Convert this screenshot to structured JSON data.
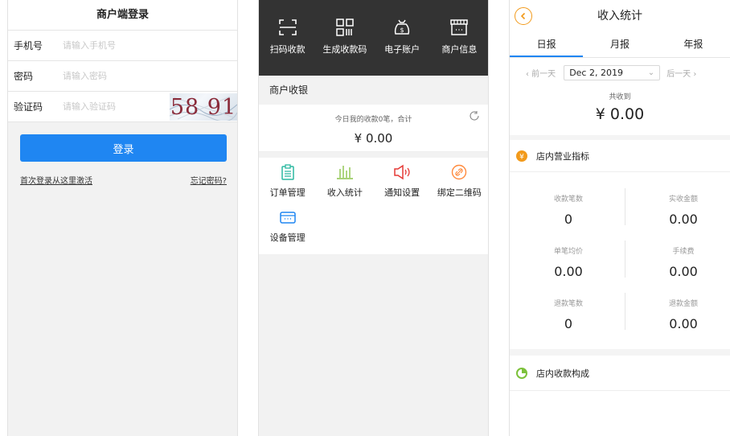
{
  "login": {
    "title": "商户端登录",
    "phone_label": "手机号",
    "phone_placeholder": "请输入手机号",
    "password_label": "密码",
    "password_placeholder": "请输入密码",
    "captcha_label": "验证码",
    "captcha_placeholder": "请输入验证码",
    "captcha_text": "58 91",
    "login_button": "登录",
    "activate_link": "首次登录从这里激活",
    "forgot_link": "忘记密码?"
  },
  "cashier": {
    "top_actions": [
      {
        "label": "扫码收款",
        "icon": "scan-icon"
      },
      {
        "label": "生成收款码",
        "icon": "qrcode-icon"
      },
      {
        "label": "电子账户",
        "icon": "money-bag-icon"
      },
      {
        "label": "商户信息",
        "icon": "shop-icon"
      }
    ],
    "section_title": "商户收银",
    "today_note": "今日我的收款0笔，合计",
    "today_amount": "¥ 0.00",
    "menu": [
      {
        "label": "订单管理",
        "icon": "clipboard-icon",
        "color": "#2bb8a0"
      },
      {
        "label": "收入统计",
        "icon": "bar-chart-icon",
        "color": "#8bc34a"
      },
      {
        "label": "通知设置",
        "icon": "speaker-icon",
        "color": "#e53935"
      },
      {
        "label": "绑定二维码",
        "icon": "link-icon",
        "color": "#ff8a3d"
      },
      {
        "label": "设备管理",
        "icon": "device-icon",
        "color": "#1f86f2"
      }
    ]
  },
  "stats": {
    "title": "收入统计",
    "tabs": [
      "日报",
      "月报",
      "年报"
    ],
    "active_tab": "日报",
    "prev_day": "‹ 前一天",
    "next_day": "后一天 ›",
    "date": "Dec 2, 2019",
    "total_label": "共收到",
    "total_amount": "¥ 0.00",
    "store_metrics_title": "店内营业指标",
    "metrics": [
      {
        "label": "收款笔数",
        "value": "0"
      },
      {
        "label": "实收金额",
        "value": "0.00"
      },
      {
        "label": "单笔均价",
        "value": "0.00"
      },
      {
        "label": "手续费",
        "value": "0.00"
      },
      {
        "label": "退款笔数",
        "value": "0"
      },
      {
        "label": "退款金额",
        "value": "0.00"
      }
    ],
    "composition_title": "店内收款构成",
    "colors": {
      "accent": "#1f86f2",
      "orange": "#f29a1b",
      "green": "#7cc13a"
    }
  }
}
